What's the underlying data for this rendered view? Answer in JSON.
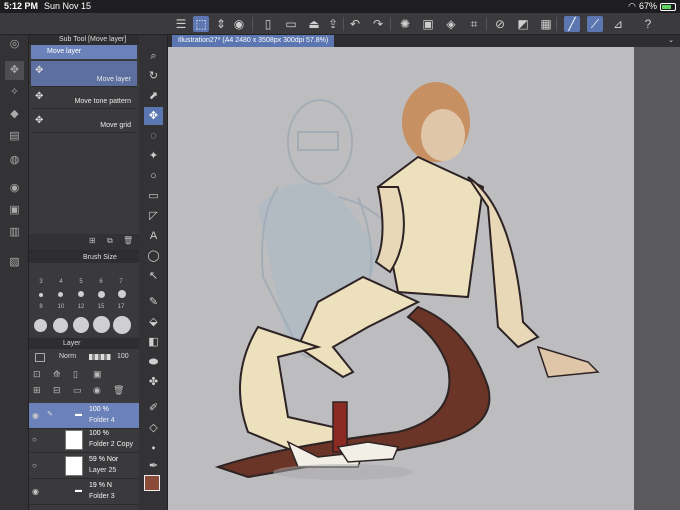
{
  "status": {
    "time": "5:12 PM",
    "date": "Sun Nov 15",
    "battery": "67%"
  },
  "subtool": {
    "title": "Sub Tool [Move layer]",
    "selected_label": "Move layer",
    "items": [
      "Move layer",
      "Move tone pattern",
      "Move grid"
    ]
  },
  "brush": {
    "title": "Brush Size",
    "row1": [
      "3",
      "4",
      "5",
      "6",
      "7"
    ],
    "row2": [
      "8",
      "10",
      "12",
      "15",
      "17"
    ]
  },
  "layer": {
    "title": "Layer",
    "blend": "Norm",
    "opacity": "100",
    "rows": [
      {
        "pct": "100 %",
        "name": "Folder 4"
      },
      {
        "pct": "100 %",
        "name": "Folder 2 Copy"
      },
      {
        "pct": "59 % Nor",
        "name": "Layer 25"
      },
      {
        "pct": "19 % N",
        "name": "Folder 3"
      }
    ]
  },
  "colors": {
    "main": "#8b4a35",
    "sub": "#ffffff",
    "accent": "#5b76b0"
  },
  "document": {
    "tab_title": "Illustration27* (A4 2480 x 3508px 300dpi 57.8%)"
  }
}
